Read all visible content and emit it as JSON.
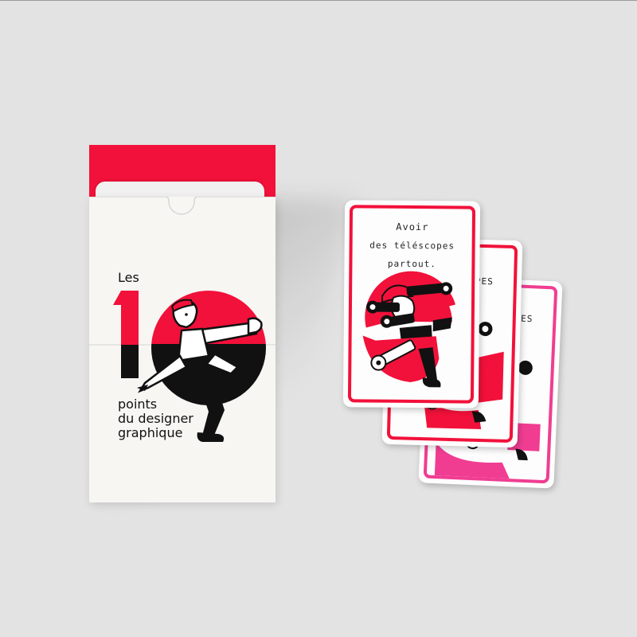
{
  "box": {
    "title_prefix": "Les",
    "number": "10",
    "subtitle_lines": [
      "points",
      "du designer",
      "graphique"
    ]
  },
  "cards": {
    "front_title_lines": [
      "Avoir",
      "des téléscopes",
      "partout."
    ],
    "second_card_partial": "PES",
    "third_card_partial": "PES"
  },
  "colors": {
    "background": "#e3e3e3",
    "accent_red": "#f2113a",
    "accent_pink": "#f03d92",
    "ink": "#111111",
    "paper": "#f7f6f3"
  }
}
